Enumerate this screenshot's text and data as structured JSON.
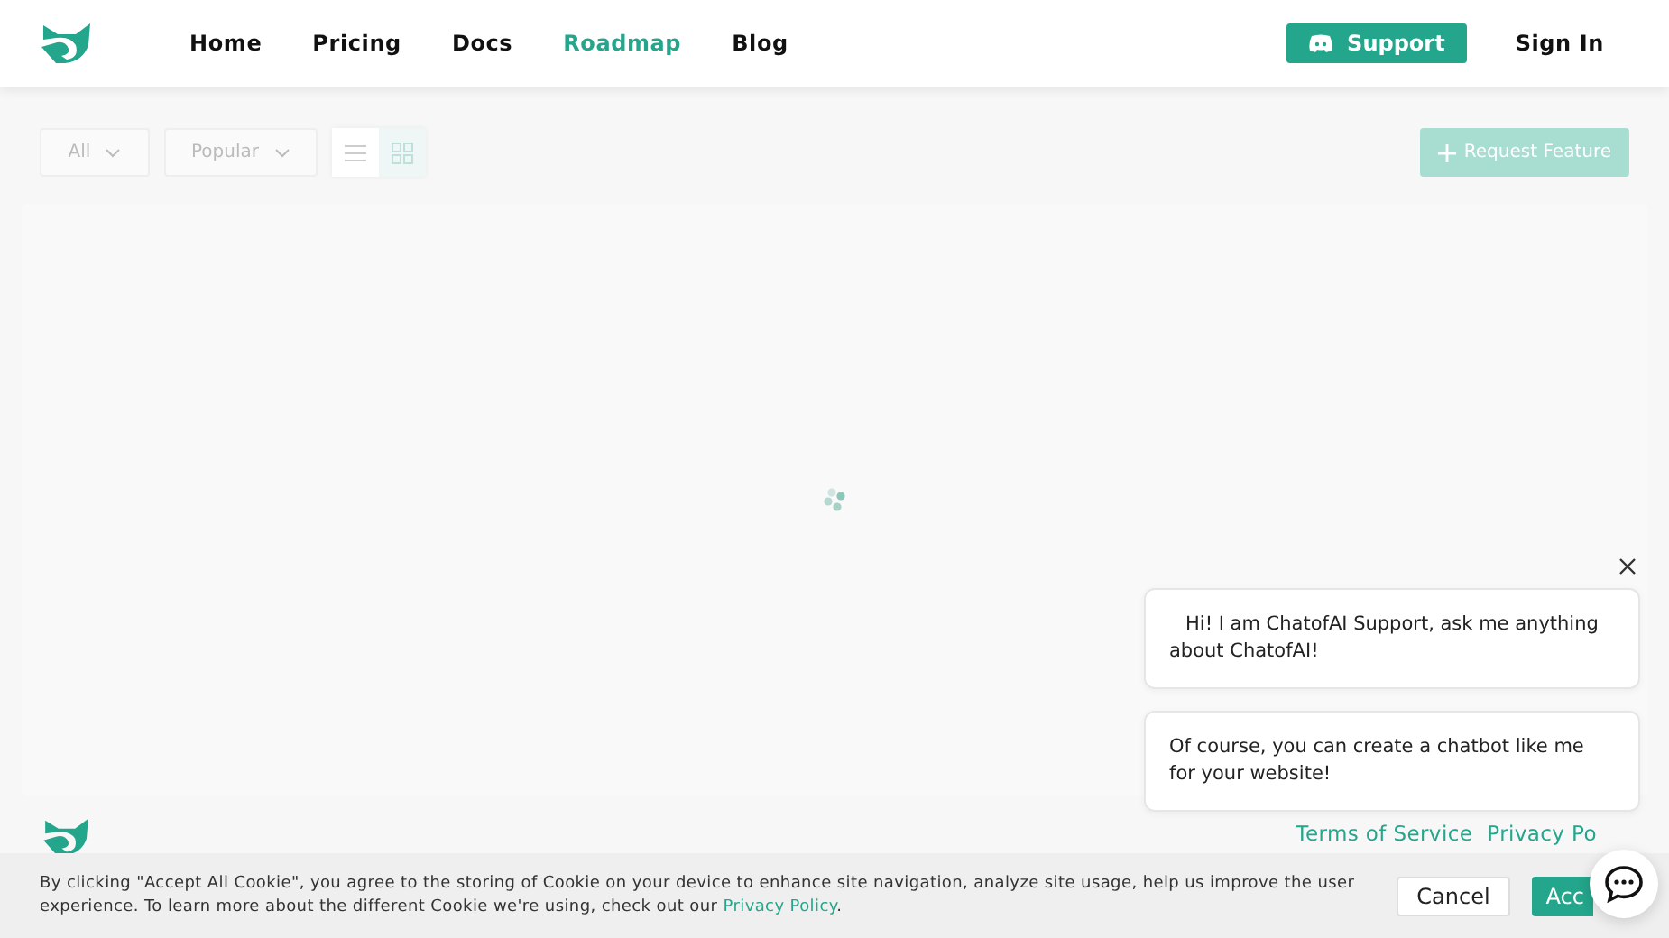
{
  "nav": {
    "links": [
      {
        "label": "Home",
        "selected": false
      },
      {
        "label": "Pricing",
        "selected": false
      },
      {
        "label": "Docs",
        "selected": false
      },
      {
        "label": "Roadmap",
        "selected": true
      },
      {
        "label": "Blog",
        "selected": false
      }
    ],
    "support": "Support",
    "signin": "Sign In"
  },
  "toolbar": {
    "filters": [
      "All",
      "Popular"
    ],
    "views": [
      {
        "kind": "list",
        "selected": false
      },
      {
        "kind": "grid",
        "selected": true
      }
    ],
    "request": "Request Feature"
  },
  "footer": {
    "links": [
      "Terms of Service",
      "Privacy Po"
    ]
  },
  "chat": {
    "messages": [
      "Hi! I am ChatofAI Support, ask me anything about ChatofAI!",
      "Of course, you can create a chatbot like me for your website!"
    ]
  },
  "cookie": {
    "text": "By clicking \"Accept All Cookie\", you agree to the storing of Cookie on your device to enhance site navigation, analyze site usage, help us improve the user experience. To learn more about the different Cookie we're using, check out our ",
    "link": "Privacy Policy",
    "after": ".",
    "cancel": "Cancel",
    "accept": "Acc"
  }
}
